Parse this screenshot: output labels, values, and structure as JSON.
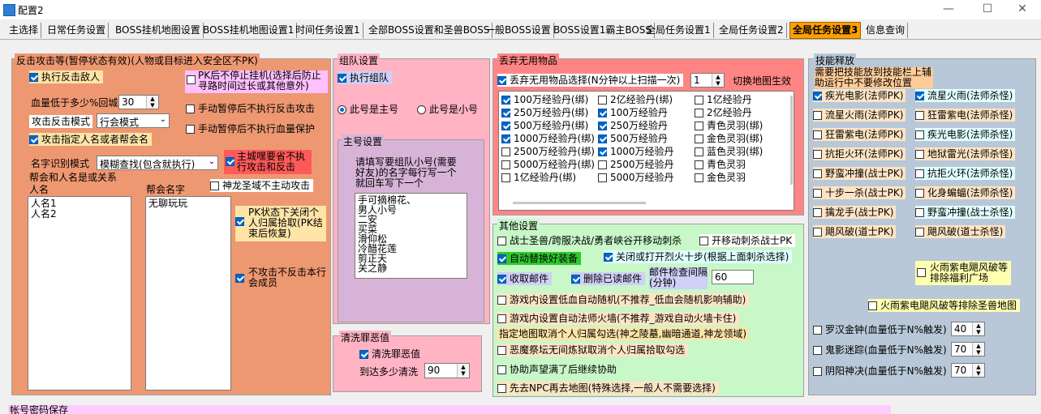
{
  "window": {
    "title": "配置2",
    "minimize": "—",
    "maximize": "☐",
    "close": "✕"
  },
  "tabs": [
    "主选择",
    "日常任务设置",
    "BOSS挂机地图设置",
    "BOSS挂机地图设置1",
    "时间任务设置1",
    "全部BOSS设置和圣兽BOSS",
    "一般BOSS设置",
    "BOSS设置1霸主BOSS",
    "全局任务设置1",
    "全局任务设置2",
    "全局任务设置3",
    "信息查询"
  ],
  "counter": {
    "title": "反击攻击等(暂停状态有效)(人物或目标进入安全区不PK)",
    "exec_counter": "执行反击敌人",
    "no_stop_pk": "PK后不停止挂机(选择后防止寻路时间过长或其他意外)",
    "hp_label": "血量低于多少%回城",
    "hp_value": "30",
    "manual_pause_counter": "手动暂停后不执行反击攻击",
    "mode_label": "攻击反击模式",
    "mode_value": "行会模式",
    "manual_pause_hp": "手动暂停后不执行血量保护",
    "attack_named": "攻击指定人名或者帮会名",
    "name_mode_label": "名字识别模式",
    "name_mode_value": "模糊查找(包含就执行)",
    "main_city_nopk": "主城嘿要省不执行攻击和反击",
    "relation_label": "帮会和人名是或关系",
    "shenlong": "神龙圣域不主动攻击",
    "person_label": "人名",
    "guild_label": "帮会名字",
    "persons": [
      "人名1",
      "人名2"
    ],
    "guilds": [
      "无聊玩玩"
    ],
    "pk_close_pickup": "PK状态下关闭个人归属拾取(PK结束后恢复)",
    "no_attack_guild": "不攻击不反击本行会成员"
  },
  "team": {
    "title": "组队设置",
    "exec_team": "执行组队",
    "radio_main": "此号是主号",
    "radio_sub": "此号是小号",
    "main_title": "主号设置",
    "main_desc": "请填写要组队小号(需要好友)的名字每行写一个就回车写下一个",
    "members": [
      "手可摘棉花、",
      "男人小号",
      "二安",
      "买菜",
      "滑仰松",
      "冷醋花莲",
      "剪正天",
      "关之静"
    ]
  },
  "purge": {
    "title": "清洗罪恶值",
    "exec": "清洗罪恶值",
    "reach_label": "到达多少清洗",
    "reach_value": "90"
  },
  "discard": {
    "title": "丢弃无用物品",
    "select_label": "丢弃无用物品选择(N分钟以上扫描一次)",
    "minutes": "1",
    "switch_effect": "切换地图生效",
    "col1": [
      [
        "100万经验丹(绑)",
        true
      ],
      [
        "250万经验丹(绑)",
        true
      ],
      [
        "500万经验丹(绑)",
        true
      ],
      [
        "1000万经验丹(绑)",
        true
      ],
      [
        "2500万经验丹(绑)",
        false
      ],
      [
        "5000万经验丹(绑)",
        false
      ],
      [
        "1亿经验丹(绑)",
        false
      ]
    ],
    "col2": [
      [
        "2亿经验丹(绑)",
        false
      ],
      [
        "100万经验丹",
        true
      ],
      [
        "250万经验丹",
        true
      ],
      [
        "500万经验丹",
        true
      ],
      [
        "1000万经验丹",
        true
      ],
      [
        "2500万经验丹",
        false
      ],
      [
        "5000万经验丹",
        false
      ]
    ],
    "col3": [
      [
        "1亿经验丹",
        false
      ],
      [
        "2亿经验丹",
        false
      ],
      [
        "青色灵羽(绑)",
        false
      ],
      [
        "金色灵羽(绑)",
        false
      ],
      [
        "蓝色灵羽(绑)",
        false
      ],
      [
        "青色灵羽",
        false
      ],
      [
        "金色灵羽",
        false
      ]
    ]
  },
  "other": {
    "title": "其他设置",
    "warrior_beast": "战士圣兽/跨服决战/勇者峡谷开移动刺杀",
    "move_stab": "开移动刺杀战士PK",
    "auto_equip": "自动替换好装备",
    "toggle_fire": "关闭或打开烈火十步(根据上面刺杀选择)",
    "collect_mail": "收取邮件",
    "delete_mail": "删除已读邮件",
    "mail_interval_label": "邮件检查间隔(分钟)",
    "mail_interval": "60",
    "low_hp_random": "游戏内设置低血自动随机(不推荐_低血会随机影响辅助)",
    "auto_firewall": "游戏内设置自动法师火墙(不推荐_游戏自动火墙卡住)",
    "cancel_pickup_maps": "指定地图取消个人归属勾选(神之陵墓,幽暗通道,神龙领域)",
    "demon_altar": "恶魔祭坛无间炼狱取消个人归属拾取勾选",
    "assist_full": "协助声望满了后继续协助",
    "npc_first": "先去NPC再去地图(特殊选择,一般人不需要选择)"
  },
  "skills": {
    "title": "技能释放",
    "note": "需要把技能放到技能栏上辅助运行中不要修改位置",
    "left": [
      [
        "疾光电影(法师PK)",
        true
      ],
      [
        "流星火雨(法师PK)",
        false
      ],
      [
        "狂雷紫电(法师PK)",
        false
      ],
      [
        "抗拒火环(法师PK)",
        false
      ],
      [
        "野蛮冲撞(战士PK)",
        false
      ],
      [
        "十步一杀(战士PK)",
        false
      ],
      [
        "擒龙手(战士PK)",
        false
      ],
      [
        "飓风破(道士PK)",
        false
      ]
    ],
    "right": [
      [
        "流星火雨(法师杀怪)",
        true
      ],
      [
        "狂雷紫电(法师杀怪)",
        false
      ],
      [
        "疾光电影(法师杀怪)",
        false
      ],
      [
        "地狱雷光(法师杀怪)",
        false
      ],
      [
        "抗拒火环(法师杀怪)",
        false
      ],
      [
        "化身蝙蝠(法师杀怪)",
        false
      ],
      [
        "野蛮冲撞(战士杀怪)",
        false
      ],
      [
        "飓风破(道士杀怪)",
        false
      ]
    ],
    "fire_rain_welfare": "火雨紫电飓风破等排除福利广场",
    "fire_rain_holy": "火雨紫电飓风破等排除圣兽地图",
    "luohan": "罗汉金钟(血量低于N%触发)",
    "luohan_value": "40",
    "guiying": "鬼影迷踪(血量低于N%触发)",
    "guiying_value": "70",
    "yinyang": "阴阳神决(血量低于N%触发)",
    "yinyang_value": "70"
  },
  "bottom": {
    "account_save": "帐号密码保存"
  }
}
